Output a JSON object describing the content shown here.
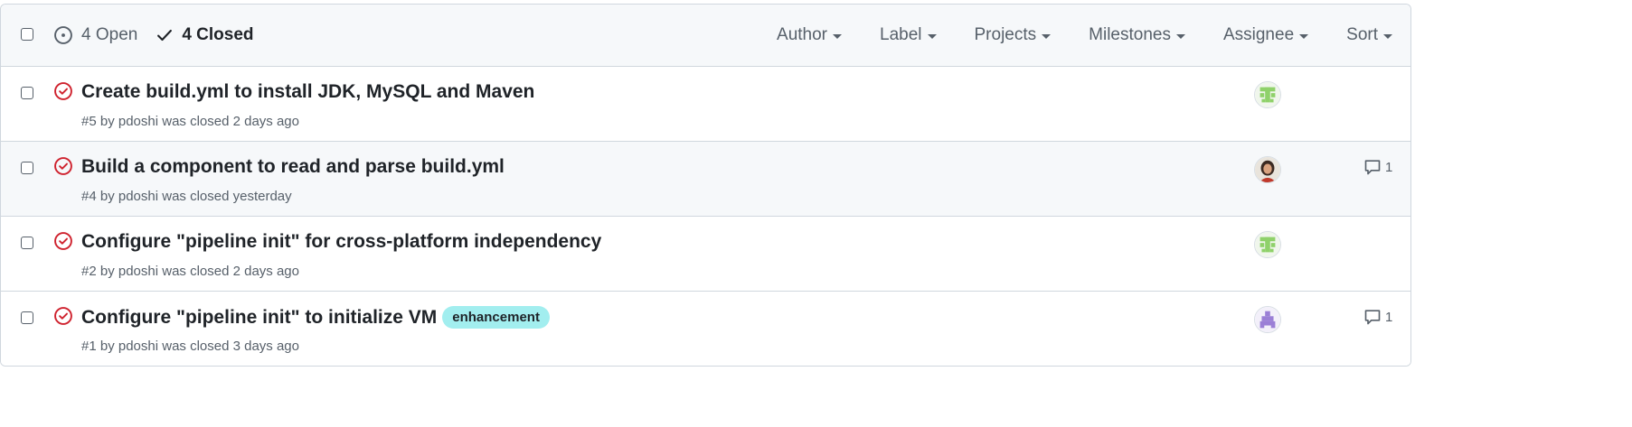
{
  "header": {
    "open_label": "4 Open",
    "closed_label": "4 Closed",
    "filters": [
      "Author",
      "Label",
      "Projects",
      "Milestones",
      "Assignee",
      "Sort"
    ]
  },
  "issues": [
    {
      "title": "Create build.yml to install JDK, MySQL and Maven",
      "meta": "#5 by pdoshi was closed 2 days ago",
      "label": "",
      "comments": "",
      "avatar": "green-identicon"
    },
    {
      "title": "Build a component to read and parse build.yml",
      "meta": "#4 by pdoshi was closed yesterday",
      "label": "",
      "comments": "1",
      "avatar": "photo-avatar"
    },
    {
      "title": "Configure \"pipeline init\" for cross-platform independency",
      "meta": "#2 by pdoshi was closed 2 days ago",
      "label": "",
      "comments": "",
      "avatar": "green-identicon"
    },
    {
      "title": "Configure \"pipeline init\" to initialize VM",
      "meta": "#1 by pdoshi was closed 3 days ago",
      "label": "enhancement",
      "comments": "1",
      "avatar": "purple-identicon"
    }
  ],
  "colors": {
    "closed_icon": "#cf222e",
    "label_bg": "#a2eeef",
    "header_bg": "#f6f8fa",
    "border": "#d0d7de"
  }
}
